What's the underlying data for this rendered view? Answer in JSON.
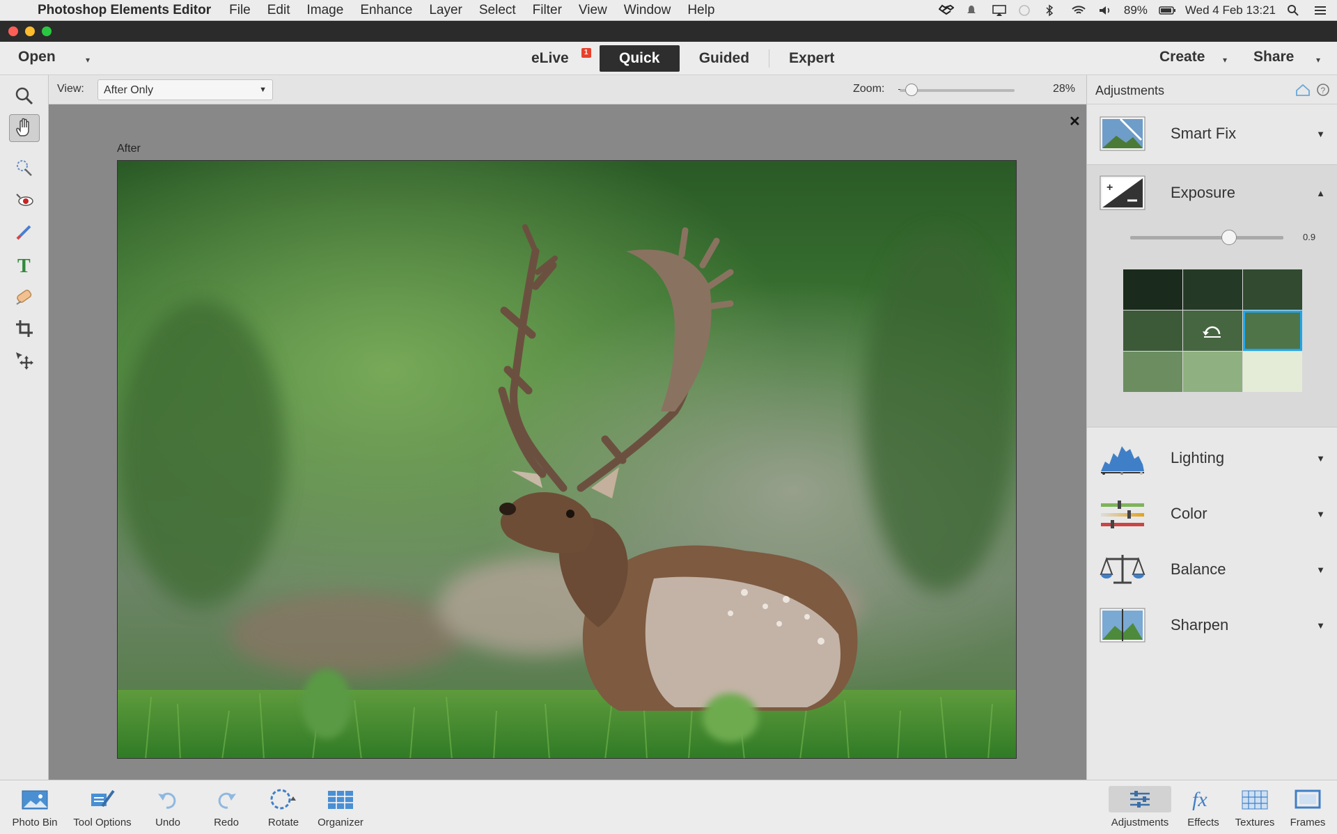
{
  "menubar": {
    "app_name": "Photoshop Elements Editor",
    "items": [
      "File",
      "Edit",
      "Image",
      "Enhance",
      "Layer",
      "Select",
      "Filter",
      "View",
      "Window",
      "Help"
    ],
    "battery": "89%",
    "datetime": "Wed 4 Feb  13:21"
  },
  "toolbar": {
    "open_label": "Open",
    "modes": [
      "eLive",
      "Quick",
      "Guided",
      "Expert"
    ],
    "active_mode": "Quick",
    "elive_badge": "1",
    "create_label": "Create",
    "share_label": "Share"
  },
  "options": {
    "view_label": "View:",
    "view_value": "After Only",
    "zoom_label": "Zoom:",
    "zoom_value": "28%"
  },
  "canvas": {
    "after_label": "After"
  },
  "panel": {
    "title": "Adjustments",
    "exposure_value": "0.9",
    "exposure_fraction": 0.55,
    "items": [
      {
        "label": "Smart Fix",
        "icon": "smart-fix-icon"
      },
      {
        "label": "Exposure",
        "icon": "exposure-icon"
      },
      {
        "label": "Lighting",
        "icon": "lighting-icon"
      },
      {
        "label": "Color",
        "icon": "color-icon"
      },
      {
        "label": "Balance",
        "icon": "balance-icon"
      },
      {
        "label": "Sharpen",
        "icon": "sharpen-icon"
      }
    ]
  },
  "bottom": {
    "left": [
      "Photo Bin",
      "Tool Options",
      "Undo",
      "Redo",
      "Rotate",
      "Organizer"
    ],
    "right": [
      "Adjustments",
      "Effects",
      "Textures",
      "Frames"
    ]
  },
  "colors": {
    "accent": "#1ea7f0",
    "badge": "#e8412c"
  }
}
